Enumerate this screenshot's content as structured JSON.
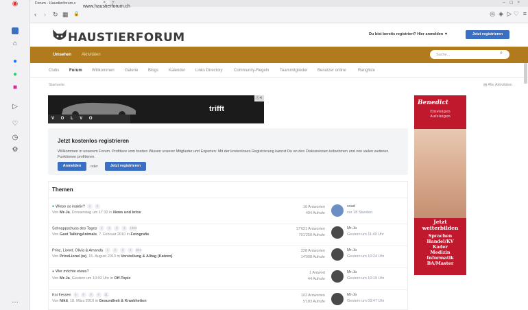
{
  "browser": {
    "tab_title": "Forum - Haustierforum.c",
    "url": "www.haustierforum.ch",
    "new_tab": "+"
  },
  "sidebar_icons": [
    "home-icon",
    "messenger-icon",
    "whatsapp-icon",
    "instagram-icon",
    "flow-icon",
    "heart-icon",
    "history-icon",
    "settings-icon"
  ],
  "header": {
    "logo": "HAUSTIERFORUM",
    "register_prompt": "Du bist bereits registriert? Hier anmelden ▼",
    "register_button": "Jetzt registrieren"
  },
  "nav": {
    "active": "Umsehen",
    "second": "Aktivitäten",
    "search_placeholder": "Suche...",
    "subnav": [
      "Clubs",
      "Forum",
      "Willkommen",
      "Galerie",
      "Blogs",
      "Kalender",
      "Links Directory",
      "Community-Regeln",
      "Teammitglieder",
      "Benutzer online",
      "Rangliste"
    ],
    "subnav_active": "Forum"
  },
  "breadcrumb": "Startseite",
  "all_activity": "Alle Aktivitäten",
  "ads": {
    "top_brand": "V O L V O",
    "top_word": "trifft",
    "side_brand": "Benedict",
    "side_sub": "Einsteigen\nAufsteigen",
    "side_headline": "Jetzt\nweiterbilden",
    "side_list": "Sprachen\nHandel/KV\nKader\nMedizin\nInformatik\nBA/Master"
  },
  "register_box": {
    "title": "Jetzt kostenlos registrieren",
    "text": "Willkommen in unserem Forum. Profitiere vom breiten Wissen unserer Mitglieder und Experten: Mit der kostenlosen Registrierung kannst Du an den Diskussionen teilnehmen und von vielen weiteren Funktionen profitieren.",
    "login_button": "Anmelden",
    "or": "oder",
    "register_button": "Jetzt registrieren"
  },
  "topics_title": "Themen",
  "topics": [
    {
      "pinned": true,
      "title": "Wieso so inaktiv?",
      "pages": [
        "1",
        "2"
      ],
      "meta_prefix": "Von ",
      "author": "Mr-Ja",
      "meta_mid": ", Donnerstag um 17:32 in ",
      "forum": "News und Infos",
      "replies": "16 Antworten",
      "views": "404 Aufrufe",
      "last_user": "soad",
      "last_time": "vor 18 Stunden",
      "avatar_color": "#6b8fc4"
    },
    {
      "pinned": false,
      "title": "Schnappschuss des Tages",
      "pages": [
        "1",
        "2",
        "3",
        "4",
        "1383"
      ],
      "meta_prefix": "Von ",
      "author": "Gast TalkingAnimals",
      "meta_mid": ", 7. Februar 2010 in ",
      "forum": "Fotografie",
      "replies": "17'621 Antworten",
      "views": "701'250 Aufrufe",
      "last_user": "Mr-Ja",
      "last_time": "Gestern um 11:49 Uhr",
      "avatar_color": "#4a4a4a"
    },
    {
      "pinned": false,
      "title": "Prinz, Lionel, Olivia & Amanda",
      "pages": [
        "1",
        "2",
        "3",
        "4",
        "301"
      ],
      "meta_prefix": "Von ",
      "author": "PrinzLionel (w)",
      "meta_mid": ", 15. August 2013 in ",
      "forum": "Vorstellung & Alltag (Katzen)",
      "replies": "228 Antworten",
      "views": "14'008 Aufrufe",
      "last_user": "Mr-Ja",
      "last_time": "Gestern um 10:24 Uhr",
      "avatar_color": "#4a4a4a"
    },
    {
      "pinned": true,
      "title": "Wer möchte etwas?",
      "pages": [],
      "meta_prefix": "Von ",
      "author": "Mr-Ja",
      "meta_mid": ", Gestern um 10:02 Uhr in ",
      "forum": "Off-Topic",
      "replies": "1 Antwort",
      "views": "44 Aufrufe",
      "last_user": "Mr-Ja",
      "last_time": "Gestern um 10:19 Uhr",
      "avatar_color": "#4a4a4a"
    },
    {
      "pinned": false,
      "title": "Koi fressen",
      "pages": [
        "1",
        "2",
        "3",
        "4",
        "11"
      ],
      "meta_prefix": "Von ",
      "author": "Nikit",
      "meta_mid": ", 18. März 2010 in ",
      "forum": "Gesundheit & Krankheiten",
      "replies": "102 Antworten",
      "views": "5'183 Aufrufe",
      "last_user": "Mr-Ja",
      "last_time": "Gestern um 09:47 Uhr",
      "avatar_color": "#4a4a4a"
    }
  ]
}
